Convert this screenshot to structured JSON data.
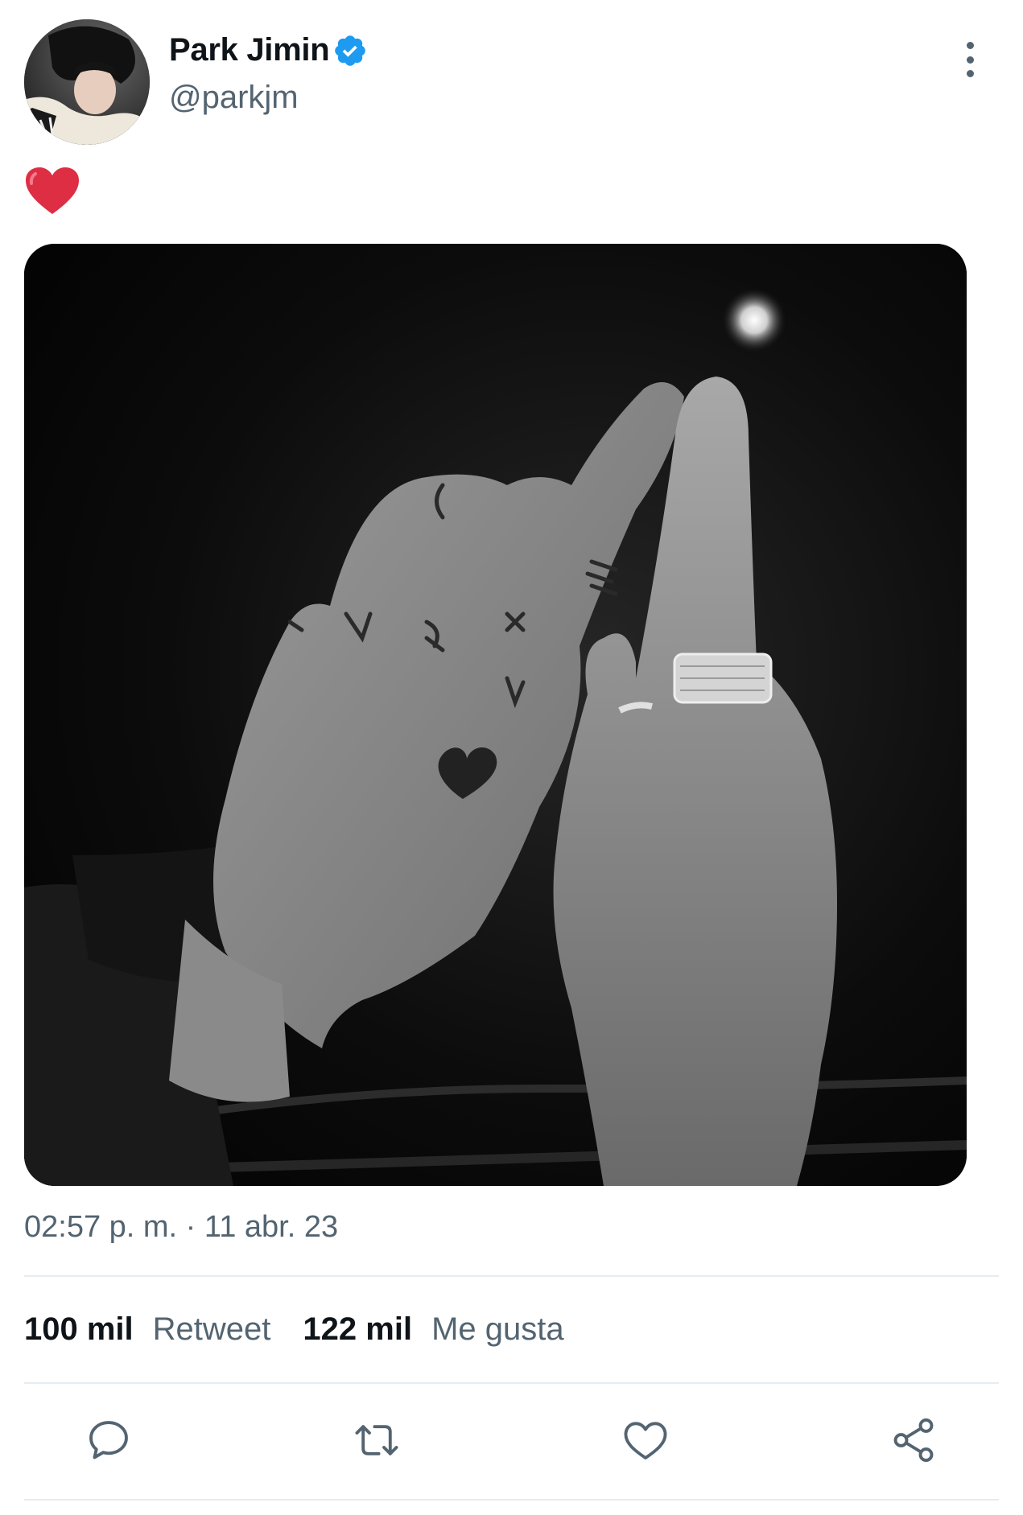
{
  "author": {
    "display_name": "Park Jimin",
    "handle": "@parkjm",
    "verified": true
  },
  "tweet": {
    "text_emoji": "red-heart",
    "media_description": "grayscale photo of two hands touching index fingers, one with hand-written letters and a heart drawn on it, wearing rings"
  },
  "meta": {
    "timestamp": "02:57 p. m. · 11 abr. 23"
  },
  "stats": {
    "retweets_count": "100 mil",
    "retweets_label": "Retweet",
    "likes_count": "122 mil",
    "likes_label": "Me gusta"
  },
  "actions": [
    {
      "icon": "reply-icon"
    },
    {
      "icon": "retweet-icon"
    },
    {
      "icon": "like-icon"
    },
    {
      "icon": "share-icon"
    }
  ],
  "colors": {
    "text_primary": "#0f1419",
    "text_secondary": "#536471",
    "verified_blue": "#1d9bf0",
    "heart_red": "#dd2e44",
    "divider": "#e6ecf0"
  }
}
